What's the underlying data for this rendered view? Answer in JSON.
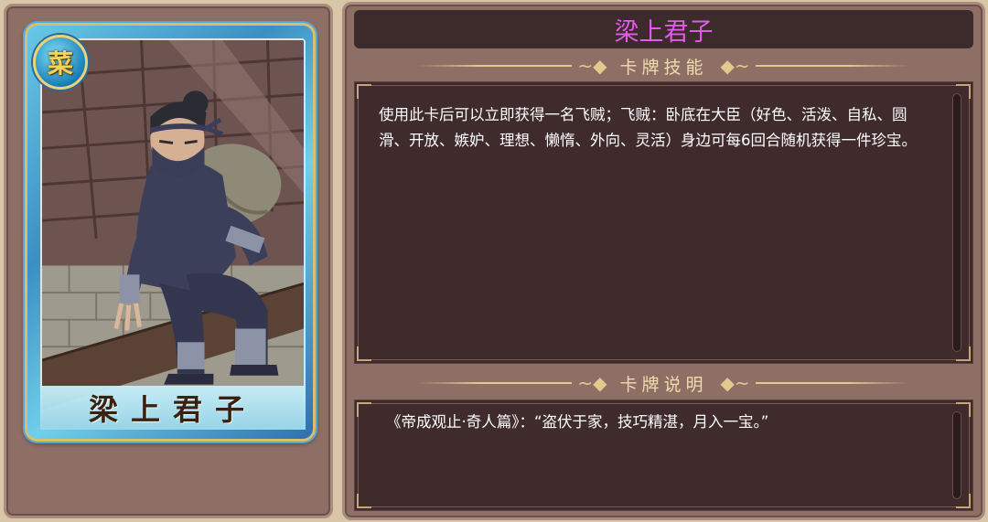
{
  "card": {
    "badge_glyph": "菜",
    "name": "梁上君子",
    "frame_color": "#3a8fc4",
    "border_color": "#d6c070"
  },
  "details": {
    "title": "梁上君子",
    "title_color": "#e05ce8",
    "skill_section": {
      "label": "卡牌技能",
      "text": "使用此卡后可以立即获得一名飞贼；飞贼：卧底在大臣（好色、活泼、自私、圆滑、开放、嫉妒、理想、懒惰、外向、灵活）身边可每6回合随机获得一件珍宝。"
    },
    "desc_section": {
      "label": "卡牌说明",
      "text": "《帝成观止·奇人篇》：“盗伏于家，技巧精湛，月入一宝。”"
    }
  }
}
